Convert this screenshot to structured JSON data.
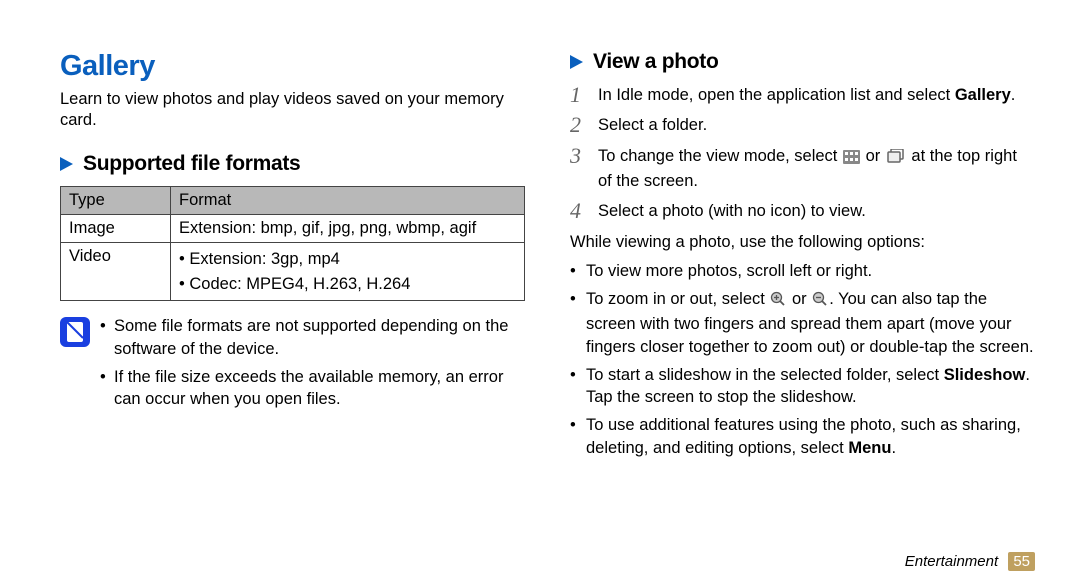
{
  "left": {
    "title": "Gallery",
    "intro": "Learn to view photos and play videos saved on your memory card.",
    "section1": "Supported file formats",
    "table": {
      "h1": "Type",
      "h2": "Format",
      "r1c1": "Image",
      "r1c2": "Extension: bmp, gif, jpg, png, wbmp, agif",
      "r2c1": "Video",
      "r2c2a": "Extension: 3gp, mp4",
      "r2c2b": "Codec: MPEG4, H.263, H.264"
    },
    "notes": {
      "n1": "Some file formats are not supported depending on the software of the device.",
      "n2": "If the file size exceeds the available memory, an error can occur when you open files."
    }
  },
  "right": {
    "section": "View a photo",
    "steps": {
      "s1a": "In Idle mode, open the application list and select ",
      "s1b": "Gallery",
      "s1c": ".",
      "s2": "Select a folder.",
      "s3a": "To change the view mode, select ",
      "s3b": " or ",
      "s3c": " at the top right of the screen.",
      "s4": "Select a photo (with no icon) to view."
    },
    "optsIntro": "While viewing a photo, use the following options:",
    "opts": {
      "o1": "To view more photos, scroll left or right.",
      "o2a": "To zoom in or out, select ",
      "o2b": " or ",
      "o2c": ". You can also tap the screen with two fingers and spread them apart (move your fingers closer together to zoom out) or double-tap the screen.",
      "o3a": "To start a slideshow in the selected folder, select ",
      "o3b": "Slideshow",
      "o3c": ". Tap the screen to stop the slideshow.",
      "o4a": "To use additional features using the photo, such as sharing, deleting, and editing options, select ",
      "o4b": "Menu",
      "o4c": "."
    }
  },
  "footer": {
    "section": "Entertainment",
    "page": "55"
  }
}
